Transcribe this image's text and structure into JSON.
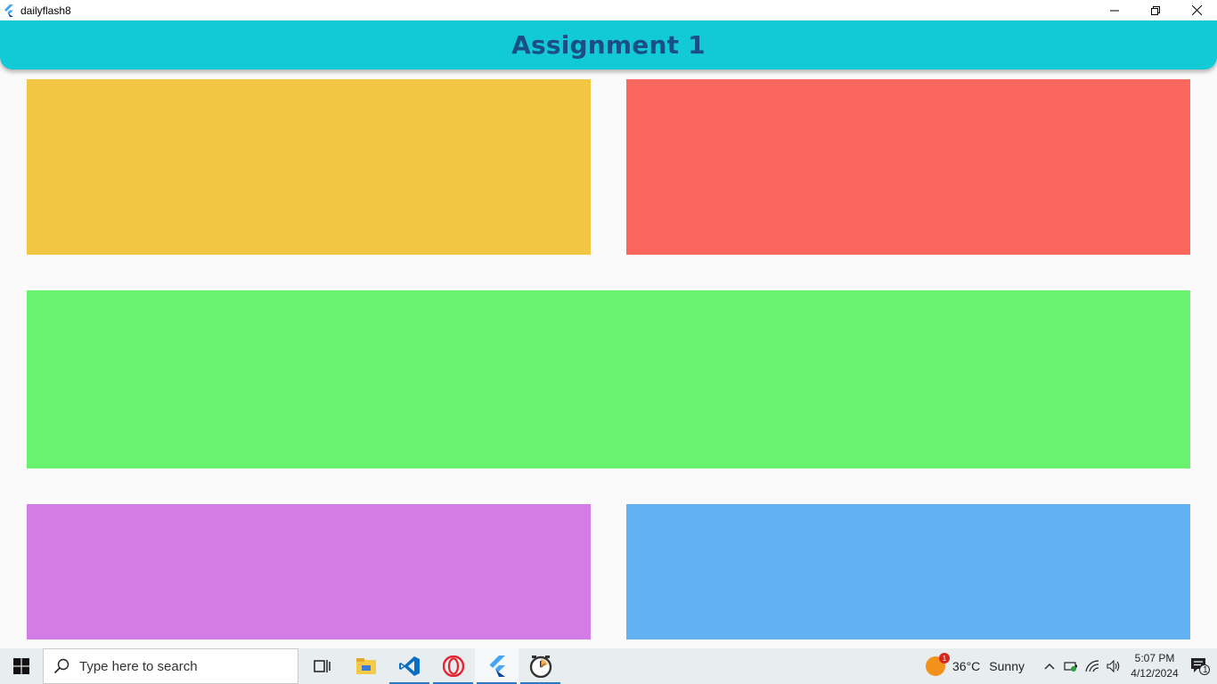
{
  "window": {
    "title": "dailyflash8",
    "icon": "flutter-icon",
    "controls": [
      "minimize-icon",
      "restore-icon",
      "close-icon"
    ]
  },
  "appbar": {
    "title": "Assignment 1",
    "background": "#12c9d6",
    "text_color": "#1a4f86"
  },
  "colors": {
    "page_background": "#fafafa",
    "box_yellow": "#f2c542",
    "box_red": "#fc675d",
    "box_green": "#69f26d",
    "box_purple": "#d47ce5",
    "box_blue": "#62b1f3"
  },
  "taskbar": {
    "search_placeholder": "Type here to search",
    "apps": [
      "task-view-icon",
      "file-explorer-icon",
      "vscode-icon",
      "opera-icon",
      "flutter-icon",
      "clock-app-icon"
    ],
    "weather": {
      "temperature": "36°C",
      "condition": "Sunny",
      "badge": "1"
    },
    "time": "5:07 PM",
    "date": "4/12/2024",
    "notification_count": "1"
  }
}
